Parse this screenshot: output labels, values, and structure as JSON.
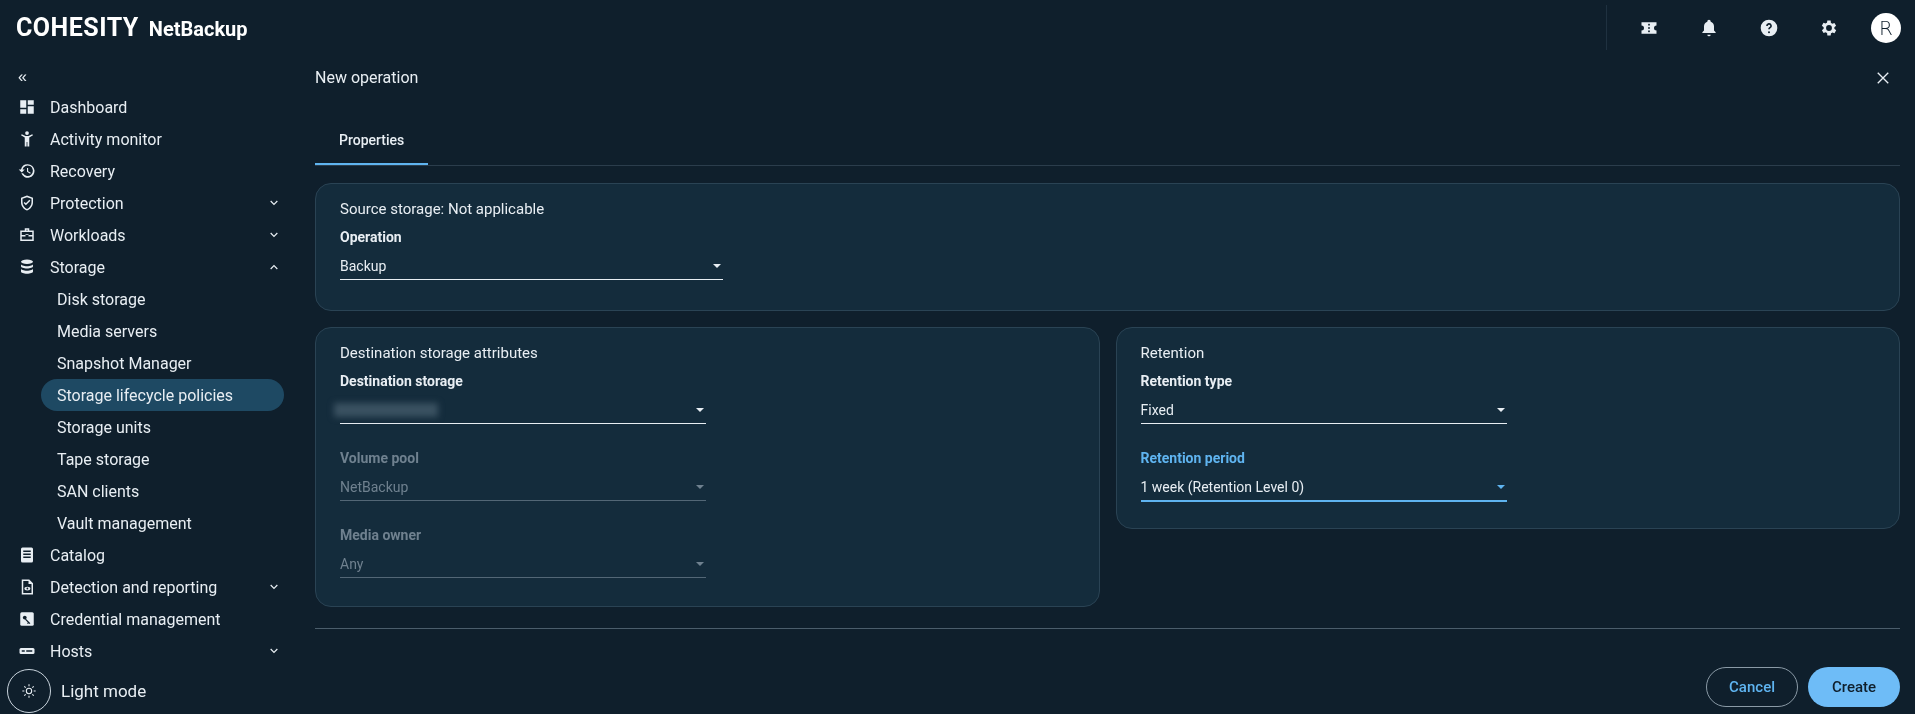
{
  "header": {
    "brand": "COHESITY",
    "product": "NetBackup",
    "avatar": "R"
  },
  "sidebar": {
    "collapse": "«",
    "items": [
      {
        "label": "Dashboard",
        "selected": false
      },
      {
        "label": "Activity monitor",
        "selected": false
      },
      {
        "label": "Recovery",
        "selected": false
      },
      {
        "label": "Protection",
        "selected": false,
        "expanded": false
      },
      {
        "label": "Workloads",
        "selected": false,
        "expanded": false
      },
      {
        "label": "Storage",
        "selected": false,
        "expanded": true,
        "children": [
          {
            "label": "Disk storage",
            "selected": false
          },
          {
            "label": "Media servers",
            "selected": false
          },
          {
            "label": "Snapshot Manager",
            "selected": false
          },
          {
            "label": "Storage lifecycle policies",
            "selected": true
          },
          {
            "label": "Storage units",
            "selected": false
          },
          {
            "label": "Tape storage",
            "selected": false
          },
          {
            "label": "SAN clients",
            "selected": false
          },
          {
            "label": "Vault management",
            "selected": false
          }
        ]
      },
      {
        "label": "Catalog",
        "selected": false
      },
      {
        "label": "Detection and reporting",
        "selected": false,
        "expanded": false
      },
      {
        "label": "Credential management",
        "selected": false
      },
      {
        "label": "Hosts",
        "selected": false,
        "expanded": false
      }
    ],
    "theme_toggle": "Light mode"
  },
  "dialog": {
    "title": "New operation",
    "tabs": [
      {
        "label": "Properties",
        "selected": true
      }
    ],
    "sections": [
      {
        "title": "Source storage: Not applicable",
        "fields": [
          {
            "label": "Operation",
            "value": "Backup",
            "disabled": false,
            "focused": false
          }
        ]
      },
      {
        "title": "Destination storage attributes",
        "fields": [
          {
            "label": "Destination storage",
            "redacted": true,
            "disabled": false,
            "focused": false
          },
          {
            "label": "Volume pool",
            "value": "NetBackup",
            "disabled": true,
            "focused": false
          },
          {
            "label": "Media owner",
            "value": "Any",
            "disabled": true,
            "focused": false
          }
        ]
      },
      {
        "title": "Retention",
        "fields": [
          {
            "label": "Retention type",
            "value": "Fixed",
            "disabled": false,
            "focused": false
          },
          {
            "label": "Retention period",
            "value": "1 week (Retention Level 0)",
            "disabled": false,
            "focused": true
          }
        ]
      }
    ],
    "buttons": [
      {
        "label": "Cancel",
        "kind": "secondary"
      },
      {
        "label": "Create",
        "kind": "primary"
      }
    ]
  }
}
